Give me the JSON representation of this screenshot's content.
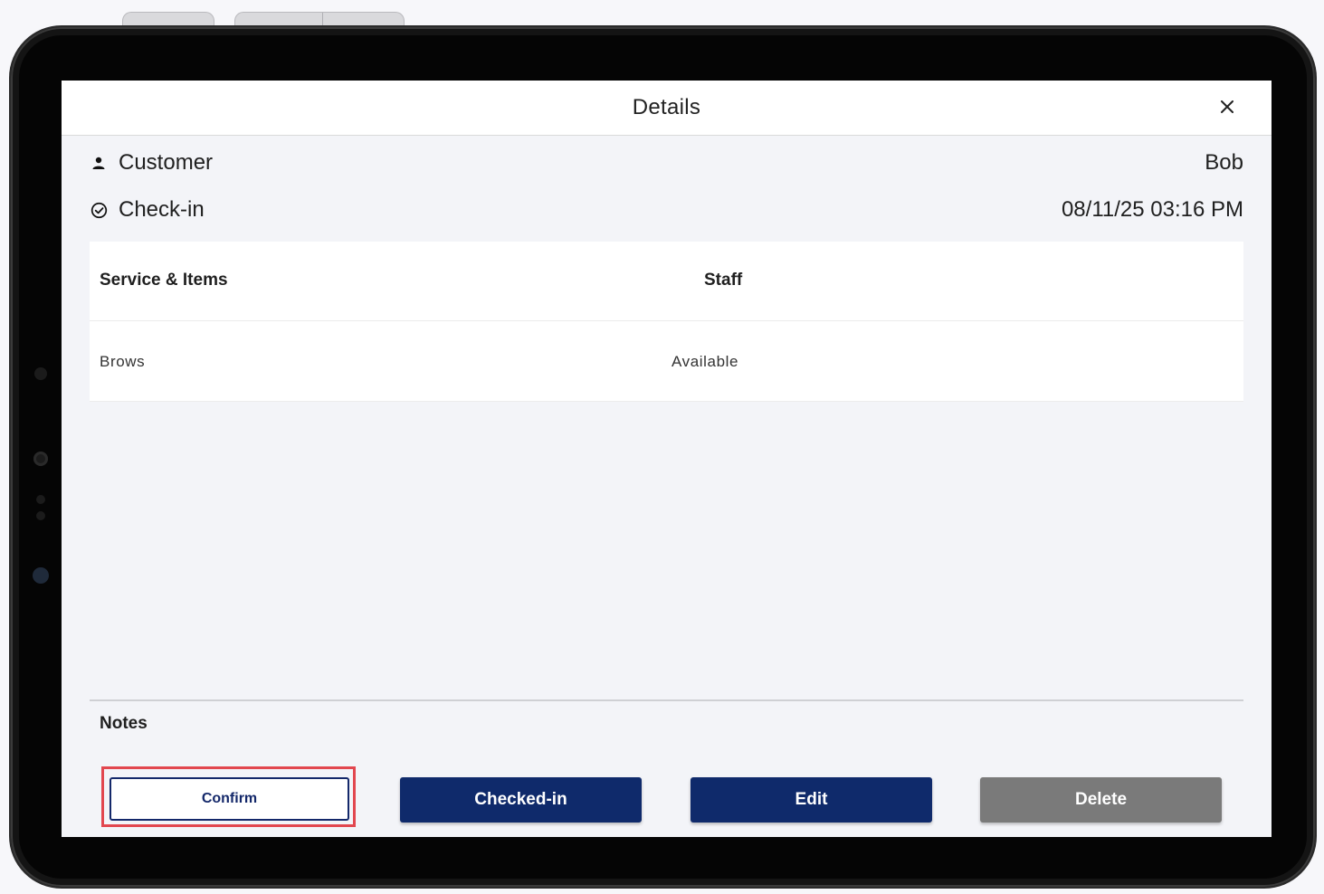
{
  "header": {
    "title": "Details",
    "close_icon": "close-icon"
  },
  "customer": {
    "icon": "person-icon",
    "label": "Customer",
    "value": "Bob"
  },
  "checkin": {
    "icon": "check-circle-icon",
    "label": "Check-in",
    "value": "08/11/25 03:16 PM"
  },
  "table": {
    "columns": [
      "Service & Items",
      "Staff"
    ],
    "rows": [
      {
        "service": "Brows",
        "staff": "Available"
      }
    ]
  },
  "notes": {
    "label": "Notes"
  },
  "actions": {
    "confirm": "Confirm",
    "checked_in": "Checked-in",
    "edit": "Edit",
    "delete": "Delete"
  },
  "colors": {
    "primary": "#0f2a6b",
    "delete": "#7a7a7a",
    "highlight": "#e2474f"
  }
}
